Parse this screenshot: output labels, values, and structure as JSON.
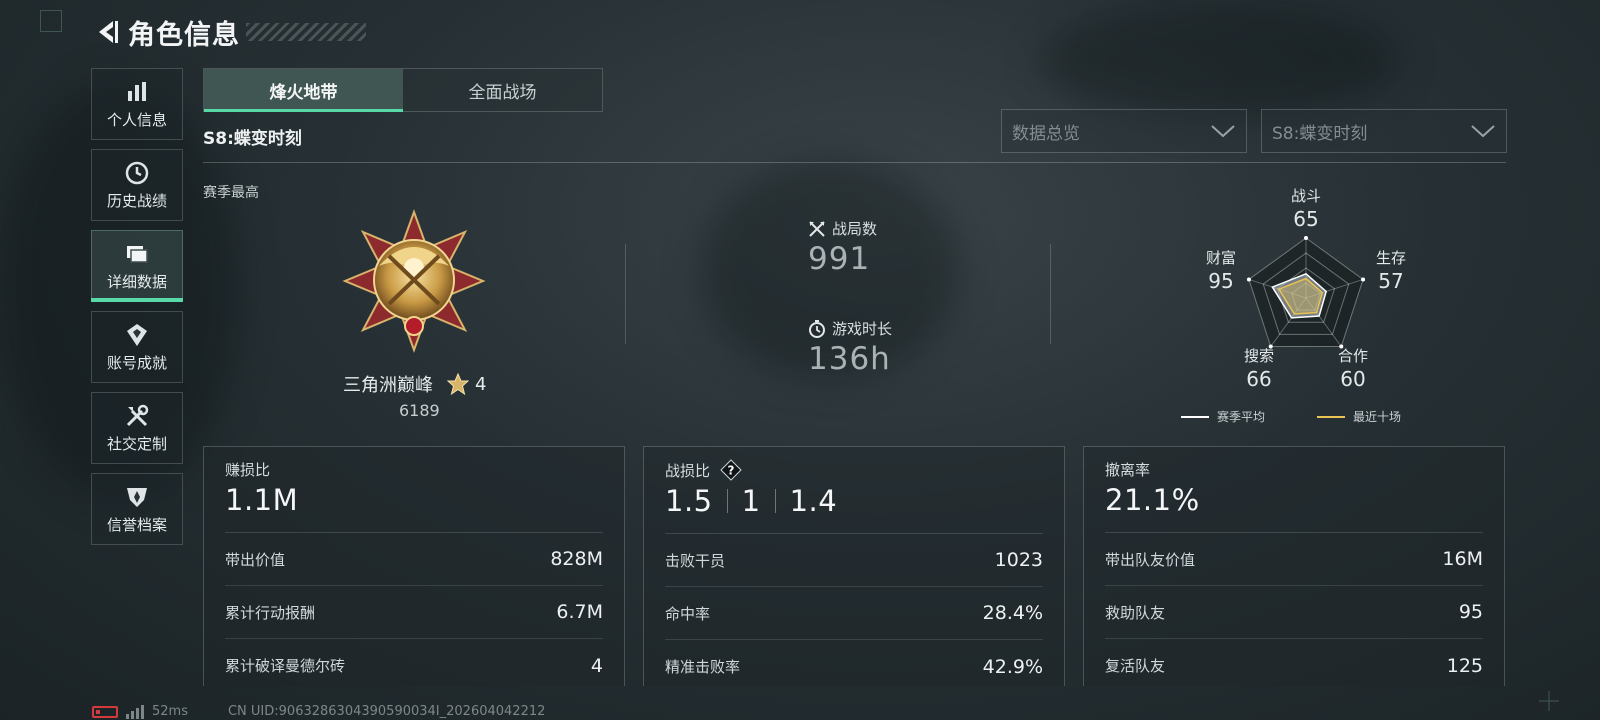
{
  "header": {
    "title": "角色信息"
  },
  "sidebar": {
    "items": [
      {
        "label": "个人信息",
        "icon": "bar-chart-icon"
      },
      {
        "label": "历史战绩",
        "icon": "clock-icon"
      },
      {
        "label": "详细数据",
        "icon": "folder-icon",
        "active": true
      },
      {
        "label": "账号成就",
        "icon": "badge-icon"
      },
      {
        "label": "社交定制",
        "icon": "tools-icon"
      },
      {
        "label": "信誉档案",
        "icon": "shield-icon"
      }
    ]
  },
  "tabs": [
    {
      "label": "烽火地带",
      "active": true
    },
    {
      "label": "全面战场",
      "active": false
    }
  ],
  "season_name": "S8:蝶变时刻",
  "filters": {
    "view": "数据总览",
    "season": "S8:蝶变时刻"
  },
  "overview": {
    "season_best_label": "赛季最高",
    "rank_name": "三角洲巅峰",
    "rank_stars": "4",
    "rank_score": "6189",
    "matches_label": "战局数",
    "matches_value": "991",
    "playtime_label": "游戏时长",
    "playtime_value": "136h"
  },
  "radar": {
    "axes": [
      {
        "label": "战斗",
        "value": "65"
      },
      {
        "label": "生存",
        "value": "57"
      },
      {
        "label": "合作",
        "value": "60"
      },
      {
        "label": "搜索",
        "value": "66"
      },
      {
        "label": "财富",
        "value": "95"
      }
    ],
    "legend": {
      "season_avg": "赛季平均",
      "recent_ten": "最近十场"
    },
    "colors": {
      "season_avg": "#ffffff",
      "recent_ten": "#e9c354"
    }
  },
  "cards": [
    {
      "title": "赚损比",
      "value": "1.1M",
      "rows": [
        {
          "label": "带出价值",
          "value": "828M"
        },
        {
          "label": "累计行动报酬",
          "value": "6.7M"
        },
        {
          "label": "累计破译曼德尔砖",
          "value": "4"
        }
      ]
    },
    {
      "title": "战损比",
      "values": [
        "1.5",
        "1",
        "1.4"
      ],
      "rows": [
        {
          "label": "击败干员",
          "value": "1023"
        },
        {
          "label": "命中率",
          "value": "28.4%"
        },
        {
          "label": "精准击败率",
          "value": "42.9%"
        }
      ]
    },
    {
      "title": "撤离率",
      "value": "21.1%",
      "rows": [
        {
          "label": "带出队友价值",
          "value": "16M"
        },
        {
          "label": "救助队友",
          "value": "95"
        },
        {
          "label": "复活队友",
          "value": "125"
        }
      ]
    }
  ],
  "status_bar": {
    "ping": "52ms",
    "uid": "CN UID:9063286304390590034I_202604042212"
  },
  "accent_color": "#59d9a7"
}
